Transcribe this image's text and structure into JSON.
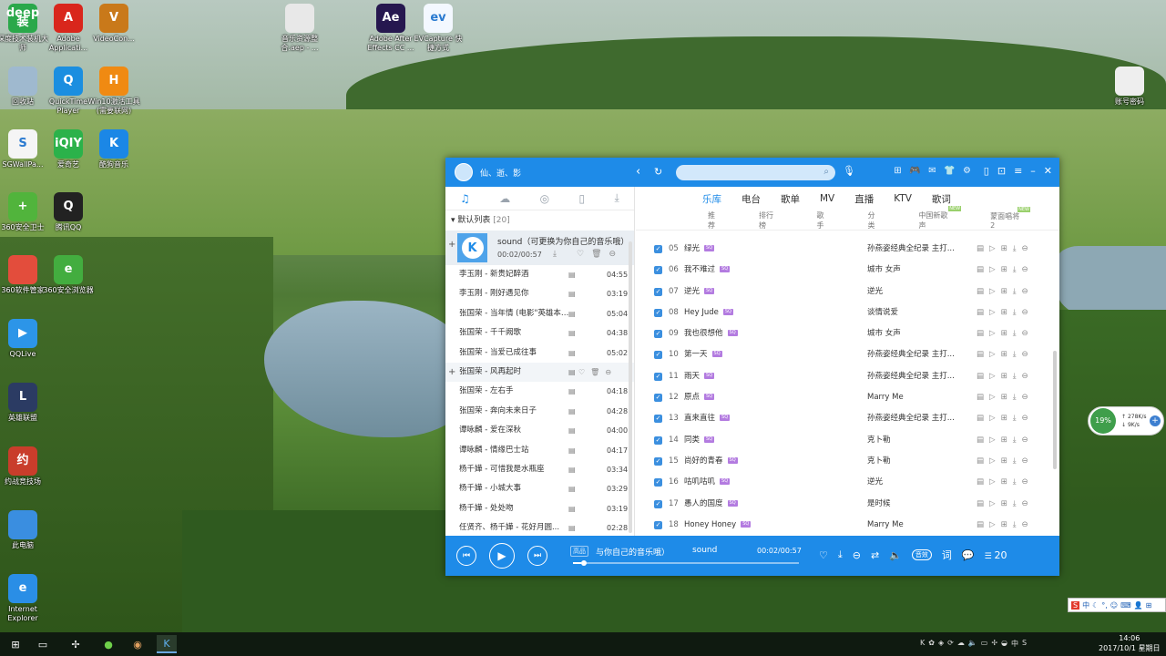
{
  "desktop_icons": [
    {
      "label": "深度技术装机大师",
      "icon": "deepin-installer-icon",
      "color": "#2aa84a",
      "glyph": "deep 装"
    },
    {
      "label": "Adobe Applicati...",
      "icon": "adobe-icon",
      "color": "#d9261c",
      "glyph": "A"
    },
    {
      "label": "VideoCon...",
      "icon": "video-converter-icon",
      "color": "#c9791a",
      "glyph": "V"
    },
    {
      "label": "音乐资源整合.aep - ...",
      "icon": "file-icon",
      "color": "#e8e8e8",
      "glyph": ""
    },
    {
      "label": "Adobe After Effects CC ...",
      "icon": "after-effects-icon",
      "color": "#26174f",
      "glyph": "Ae"
    },
    {
      "label": "EVCapture 快捷方式",
      "icon": "evcapture-icon",
      "color": "#f3f8ff",
      "glyph": "ev"
    },
    {
      "label": "回收站",
      "icon": "recycle-bin-icon",
      "color": "#9fb9cf",
      "glyph": ""
    },
    {
      "label": "QuickTime Player",
      "icon": "quicktime-icon",
      "color": "#1b8ee0",
      "glyph": "Q"
    },
    {
      "label": "Win10激活工具(需要联网)",
      "icon": "win10-activator-icon",
      "color": "#f08a12",
      "glyph": "H"
    },
    {
      "label": "账号密码",
      "icon": "file-icon",
      "color": "#eeeeee",
      "glyph": ""
    },
    {
      "label": "SGWallPa...",
      "icon": "sgwallpaper-icon",
      "color": "#f5f5f5",
      "glyph": "S"
    },
    {
      "label": "爱奇艺",
      "icon": "iqiyi-icon",
      "color": "#2bb24a",
      "glyph": "iQIY"
    },
    {
      "label": "酷狗音乐",
      "icon": "kugou-icon",
      "color": "#1b87e6",
      "glyph": "K"
    },
    {
      "label": "360安全卫士",
      "icon": "360-guard-icon",
      "color": "#51b43c",
      "glyph": "+"
    },
    {
      "label": "腾讯QQ",
      "icon": "qq-icon",
      "color": "#222222",
      "glyph": "Q"
    },
    {
      "label": "360软件管家",
      "icon": "360-software-icon",
      "color": "#e34d3c",
      "glyph": ""
    },
    {
      "label": "360安全浏览器",
      "icon": "360-browser-icon",
      "color": "#43ad3f",
      "glyph": "e"
    },
    {
      "label": "QQLive",
      "icon": "qqlive-icon",
      "color": "#2c95e8",
      "glyph": "▶"
    },
    {
      "label": "英雄联盟",
      "icon": "league-icon",
      "color": "#2b3b63",
      "glyph": "L"
    },
    {
      "label": "约战竞技场",
      "icon": "arena-icon",
      "color": "#c93d2b",
      "glyph": "约"
    },
    {
      "label": "此电脑",
      "icon": "this-pc-icon",
      "color": "#3a8ee0",
      "glyph": ""
    },
    {
      "label": "Internet Explorer",
      "icon": "ie-icon",
      "color": "#2a8ee6",
      "glyph": "e"
    }
  ],
  "player": {
    "username": "仙、逝、影",
    "search_placeholder": "",
    "left_tabs": [
      "♫",
      "☁",
      "((·))",
      "▯",
      "⤓"
    ],
    "default_list_label": "默认列表",
    "default_list_count": "[20]",
    "now_playing": {
      "title": "sound（可更换为你自己的音乐哦）",
      "time": "00:02/00:57"
    },
    "playlist": [
      {
        "name": "李玉刚 - 新贵妃醉酒",
        "dur": "04:55"
      },
      {
        "name": "李玉刚 - 刚好遇见你",
        "dur": "03:19"
      },
      {
        "name": "张国荣 - 当年情 (电影\"英雄本…",
        "dur": "05:04"
      },
      {
        "name": "张国荣 - 千千阙歌",
        "dur": "04:38"
      },
      {
        "name": "张国荣 - 当爱已成往事",
        "dur": "05:02"
      },
      {
        "name": "张国荣 - 风再起时",
        "dur": ""
      },
      {
        "name": "张国荣 - 左右手",
        "dur": "04:18"
      },
      {
        "name": "张国荣 - 奔向未来日子",
        "dur": "04:28"
      },
      {
        "name": "谭咏麟 - 爱在深秋",
        "dur": "04:00"
      },
      {
        "name": "谭咏麟 - 情缘巴士站",
        "dur": "04:17"
      },
      {
        "name": "杨千嬅 - 可惜我是水瓶座",
        "dur": "03:34"
      },
      {
        "name": "杨千嬅 - 小城大事",
        "dur": "03:29"
      },
      {
        "name": "杨千嬅 - 处处吻",
        "dur": "03:19"
      },
      {
        "name": "任贤齐、杨千嬅 - 花好月圆...",
        "dur": "02:28"
      }
    ],
    "main_tabs": [
      "乐库",
      "电台",
      "歌单",
      "MV",
      "直播",
      "KTV",
      "歌词"
    ],
    "sub_tabs": [
      "推荐",
      "排行榜",
      "歌手",
      "分类",
      "中国新歌声",
      "蒙面唱将2"
    ],
    "songs": [
      {
        "num": "05",
        "title": "绿光",
        "hq": "SQ",
        "album": "孙燕姿经典全纪录 主打..."
      },
      {
        "num": "06",
        "title": "我不难过",
        "hq": "SQ",
        "album": "城市 女声"
      },
      {
        "num": "07",
        "title": "逆光",
        "hq": "SQ",
        "album": "逆光"
      },
      {
        "num": "08",
        "title": "Hey Jude",
        "hq": "SQ",
        "album": "谈情说爱"
      },
      {
        "num": "09",
        "title": "我也很想他",
        "hq": "SQ",
        "album": "城市 女声"
      },
      {
        "num": "10",
        "title": "第一天",
        "hq": "SQ",
        "album": "孙燕姿经典全纪录 主打..."
      },
      {
        "num": "11",
        "title": "雨天",
        "hq": "SQ",
        "album": "孙燕姿经典全纪录 主打..."
      },
      {
        "num": "12",
        "title": "原点",
        "hq": "SQ",
        "album": "Marry Me"
      },
      {
        "num": "13",
        "title": "直来直往",
        "hq": "SQ",
        "album": "孙燕姿经典全纪录 主打..."
      },
      {
        "num": "14",
        "title": "同类",
        "hq": "SQ",
        "album": "克卜勒"
      },
      {
        "num": "15",
        "title": "尚好的青春",
        "hq": "SQ",
        "album": "克卜勒"
      },
      {
        "num": "16",
        "title": "咕叽咕叽",
        "hq": "SQ",
        "album": "逆光"
      },
      {
        "num": "17",
        "title": "愚人的国度",
        "hq": "SQ",
        "album": "是时候"
      },
      {
        "num": "18",
        "title": "Honey Honey",
        "hq": "SQ",
        "album": "Marry Me"
      }
    ],
    "bottom": {
      "quality": "高品",
      "marquee": "与你自己的音乐哦）",
      "title": "sound",
      "time": "00:02/00:57",
      "progress": 0.035,
      "sound_fx": "音效",
      "lyrics": "词",
      "list_count": "20"
    }
  },
  "netmeter": {
    "percent": "19%",
    "up": "278K/s",
    "down": "9K/s"
  },
  "ime_label": "中",
  "clock": {
    "time": "14:06",
    "date": "2017/10/1 星期日"
  },
  "colors": {
    "accent": "#1e8be8",
    "hq_badge": "#b37be0"
  }
}
